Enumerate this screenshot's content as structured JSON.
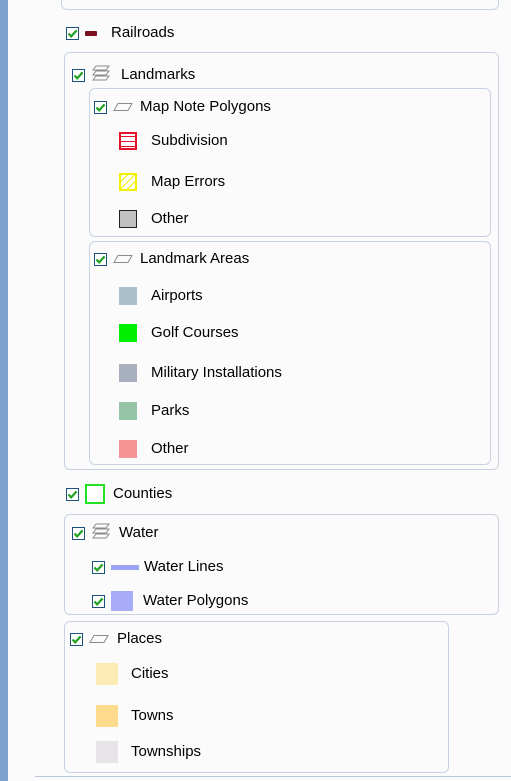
{
  "colors": {
    "check": "#21a121",
    "railroad": "#7a1020",
    "subdivision": "#e8102a",
    "map_errors": "#f2f200",
    "other_note": "#c0c0c0",
    "airports": "#a9bfcb",
    "golf": "#00f000",
    "military": "#a8afbf",
    "parks": "#96c4a6",
    "other_landmark": "#f59494",
    "counties": "#22e022",
    "water_lines": "#9aa4f2",
    "water_polygons": "#a8acf8",
    "cities": "#fdebb6",
    "towns": "#fdda8c",
    "townships": "#e7e3e8"
  },
  "layers": {
    "railroads": {
      "label": "Railroads",
      "icon": "line-symbol-icon"
    },
    "landmarks": {
      "label": "Landmarks",
      "icon": "group-layer-icon",
      "map_note_polygons": {
        "label": "Map Note Polygons",
        "icon": "polygon-layer-icon",
        "items": [
          {
            "label": "Subdivision"
          },
          {
            "label": "Map Errors"
          },
          {
            "label": "Other"
          }
        ]
      },
      "landmark_areas": {
        "label": "Landmark Areas",
        "icon": "polygon-layer-icon",
        "items": [
          {
            "label": "Airports"
          },
          {
            "label": "Golf Courses"
          },
          {
            "label": "Military Installations"
          },
          {
            "label": "Parks"
          },
          {
            "label": "Other"
          }
        ]
      }
    },
    "counties": {
      "label": "Counties"
    },
    "water": {
      "label": "Water",
      "icon": "group-layer-icon",
      "water_lines": {
        "label": "Water Lines"
      },
      "water_polygons": {
        "label": "Water Polygons"
      }
    },
    "places": {
      "label": "Places",
      "icon": "polygon-layer-icon",
      "items": [
        {
          "label": "Cities"
        },
        {
          "label": "Towns"
        },
        {
          "label": "Townships"
        }
      ]
    }
  }
}
